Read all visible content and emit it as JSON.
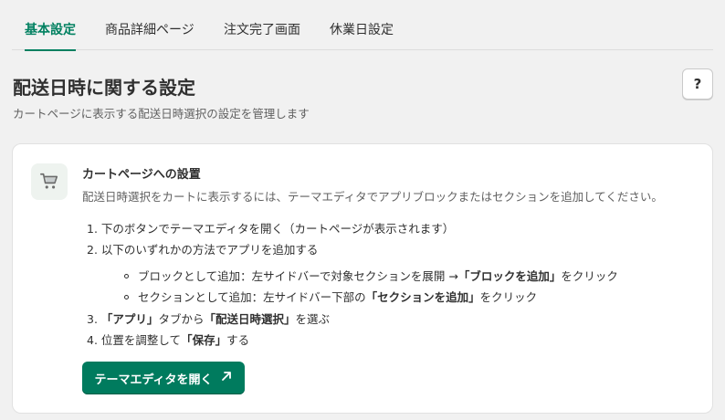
{
  "tabs": [
    {
      "label": "基本設定",
      "active": true
    },
    {
      "label": "商品詳細ページ",
      "active": false
    },
    {
      "label": "注文完了画面",
      "active": false
    },
    {
      "label": "休業日設定",
      "active": false
    }
  ],
  "header": {
    "title": "配送日時に関する設定",
    "subtitle": "カートページに表示する配送日時選択の設定を管理します",
    "help_label": "?"
  },
  "card": {
    "icon": "shopping-cart-icon",
    "title": "カートページへの設置",
    "description": "配送日時選択をカートに表示するには、テーマエディタでアプリブロックまたはセクションを追加してください。",
    "steps": [
      {
        "num": "1.",
        "text": "下のボタンでテーマエディタを開く（カートページが表示されます）"
      },
      {
        "num": "2.",
        "text": "以下のいずれかの方法でアプリを追加する"
      },
      {
        "num": "3.",
        "pre": "「アプリ」",
        "mid": "タブから",
        "bold": "「配送日時選択」",
        "post": "を選ぶ"
      },
      {
        "num": "4.",
        "pre": "位置を調整して",
        "bold": "「保存」",
        "post": "する"
      }
    ],
    "bullets": [
      {
        "pre": "ブロックとして追加：左サイドバーで対象セクションを展開 →",
        "bold": "「ブロックを追加」",
        "post": "をクリック"
      },
      {
        "pre": "セクションとして追加：左サイドバー下部の",
        "bold": "「セクションを追加」",
        "post": "をクリック"
      }
    ],
    "button_label": "テーマエディタを開く",
    "button_icon": "arrow-up-right-icon"
  },
  "colors": {
    "accent": "#008060",
    "button_bg": "#007b5e"
  }
}
